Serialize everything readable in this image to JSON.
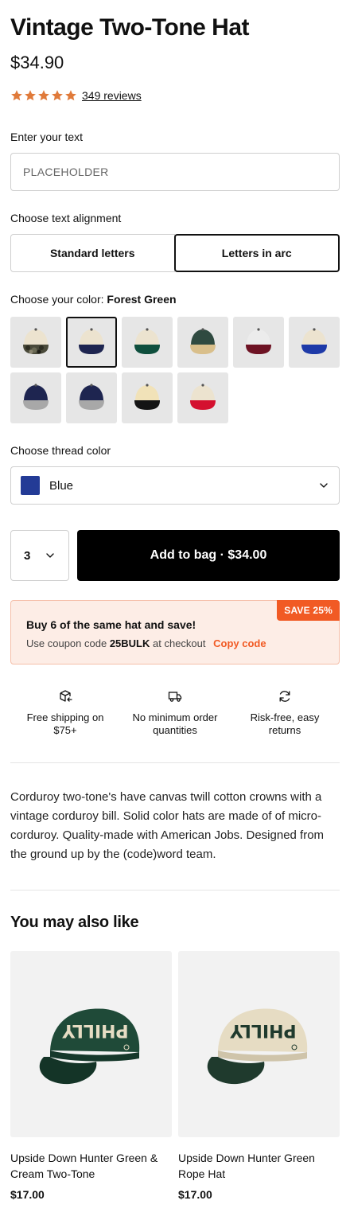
{
  "product": {
    "title": "Vintage Two-Tone Hat",
    "price": "$34.90",
    "rating": 5,
    "star_color": "#e07a3a",
    "reviews_link": "349 reviews"
  },
  "text_input": {
    "label": "Enter your text",
    "placeholder": "PLACEHOLDER"
  },
  "alignment": {
    "label": "Choose text alignment",
    "options": [
      "Standard letters",
      "Letters in arc"
    ],
    "selected": "Letters in arc"
  },
  "color": {
    "label_prefix": "Choose your color:",
    "selected_name": "Forest Green",
    "swatches": [
      {
        "crown": "#ece3cf",
        "bill": "#4a4a3a",
        "camo": true
      },
      {
        "crown": "#ece3cf",
        "bill": "#1e2550",
        "selected": true
      },
      {
        "crown": "#ece3cf",
        "bill": "#0f4f3d"
      },
      {
        "crown": "#2f4a40",
        "bill": "#d9bf8b"
      },
      {
        "crown": "#ececec",
        "bill": "#6e1324"
      },
      {
        "crown": "#ece3cf",
        "bill": "#1e3aa8"
      },
      {
        "crown": "#1e2550",
        "bill": "#a8a8a8"
      },
      {
        "crown": "#1e2550",
        "bill": "#a8a8a8"
      },
      {
        "crown": "#f1e2b8",
        "bill": "#141414"
      },
      {
        "crown": "#ece3cf",
        "bill": "#d4102f"
      }
    ]
  },
  "thread": {
    "label": "Choose thread color",
    "selected": "Blue",
    "chip_color": "#233b96",
    "chevron_icon": "chevron-down-icon"
  },
  "purchase": {
    "quantity": "3",
    "add_to_bag": "Add to bag · $34.00"
  },
  "promo": {
    "badge": "SAVE 25%",
    "title": "Buy 6 of the same hat and save!",
    "line_prefix": "Use coupon code",
    "code": "25BULK",
    "line_suffix": "at checkout",
    "copy_label": "Copy code",
    "accent": "#f15a24"
  },
  "features": [
    {
      "icon": "box-return-icon",
      "text": "Free shipping on $75+"
    },
    {
      "icon": "truck-icon",
      "text": "No minimum order quantities"
    },
    {
      "icon": "refresh-icon",
      "text": "Risk-free, easy returns"
    }
  ],
  "description": "Corduroy two-tone's have canvas twill cotton crowns with a vintage corduroy bill. Solid color hats are made of of micro-corduroy.  Quality-made with American Jobs.  Designed from the ground up by the (code)word team.",
  "related": {
    "title": "You may also like",
    "items": [
      {
        "name": "Upside Down Hunter Green & Cream Two-Tone",
        "price": "$17.00",
        "crown": "#1f4a38",
        "bill": "#1f4a38",
        "lettering": "PHILLY"
      },
      {
        "name": "Upside Down Hunter Green Rope Hat",
        "price": "$17.00",
        "crown": "#e6dcc3",
        "bill": "#1f3a2d",
        "lettering": "PHILLY"
      }
    ]
  }
}
